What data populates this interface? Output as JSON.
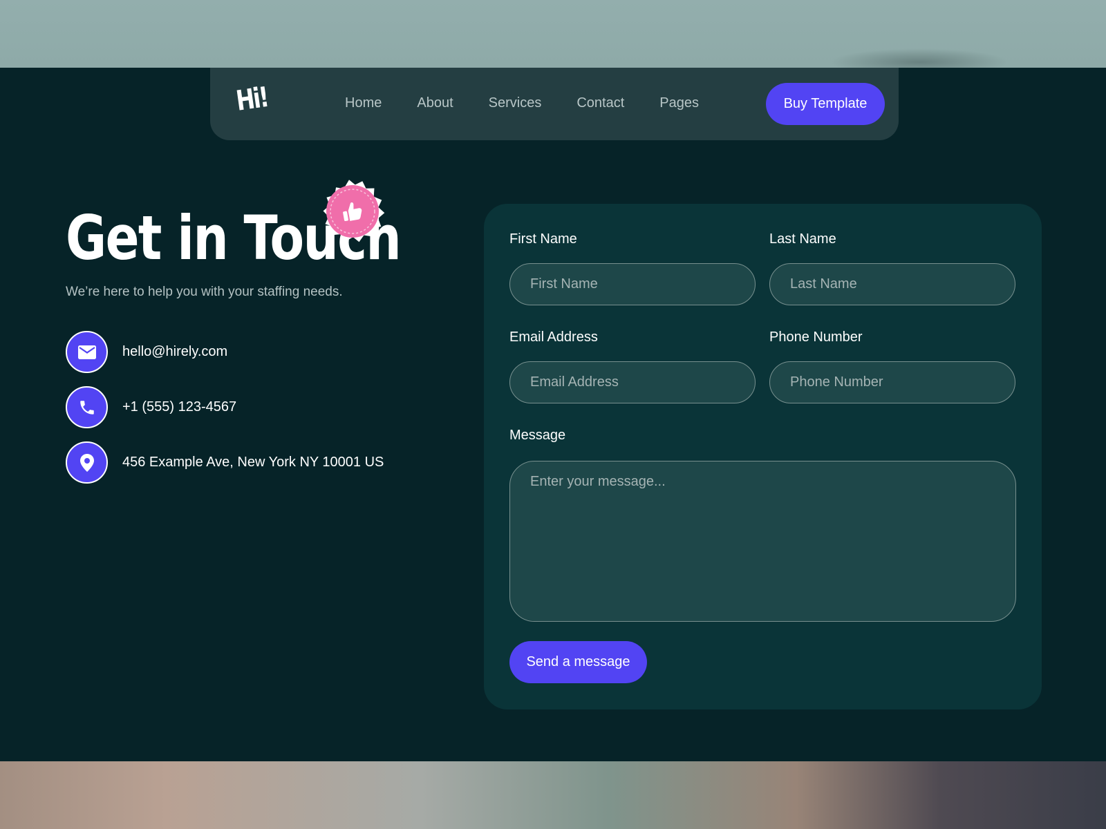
{
  "nav": {
    "logo": "Hi!",
    "links": [
      "Home",
      "About",
      "Services",
      "Contact",
      "Pages"
    ],
    "cta": "Buy Template"
  },
  "hero": {
    "title": "Get in Touch",
    "subtitle": "We’re here to help you with your staffing needs.",
    "badge_icon": "thumbs-up-icon"
  },
  "contacts": [
    {
      "icon": "mail-icon",
      "text": "hello@hirely.com"
    },
    {
      "icon": "phone-icon",
      "text": "+1 (555) 123-4567"
    },
    {
      "icon": "location-pin-icon",
      "text": "456 Example Ave, New York NY 10001 US"
    }
  ],
  "form": {
    "first_name": {
      "label": "First Name",
      "placeholder": "First Name",
      "value": ""
    },
    "last_name": {
      "label": "Last Name",
      "placeholder": "Last Name",
      "value": ""
    },
    "email": {
      "label": "Email Address",
      "placeholder": "Email Address",
      "value": ""
    },
    "phone": {
      "label": "Phone Number",
      "placeholder": "Phone Number",
      "value": ""
    },
    "message": {
      "label": "Message",
      "placeholder": "Enter your message...",
      "value": ""
    },
    "submit": "Send a message"
  },
  "colors": {
    "background": "#062328",
    "nav_background": "#243e42",
    "card_background": "#0a3438",
    "input_background": "#1e4749",
    "accent": "#5244f3",
    "badge": "#f06eaa"
  }
}
